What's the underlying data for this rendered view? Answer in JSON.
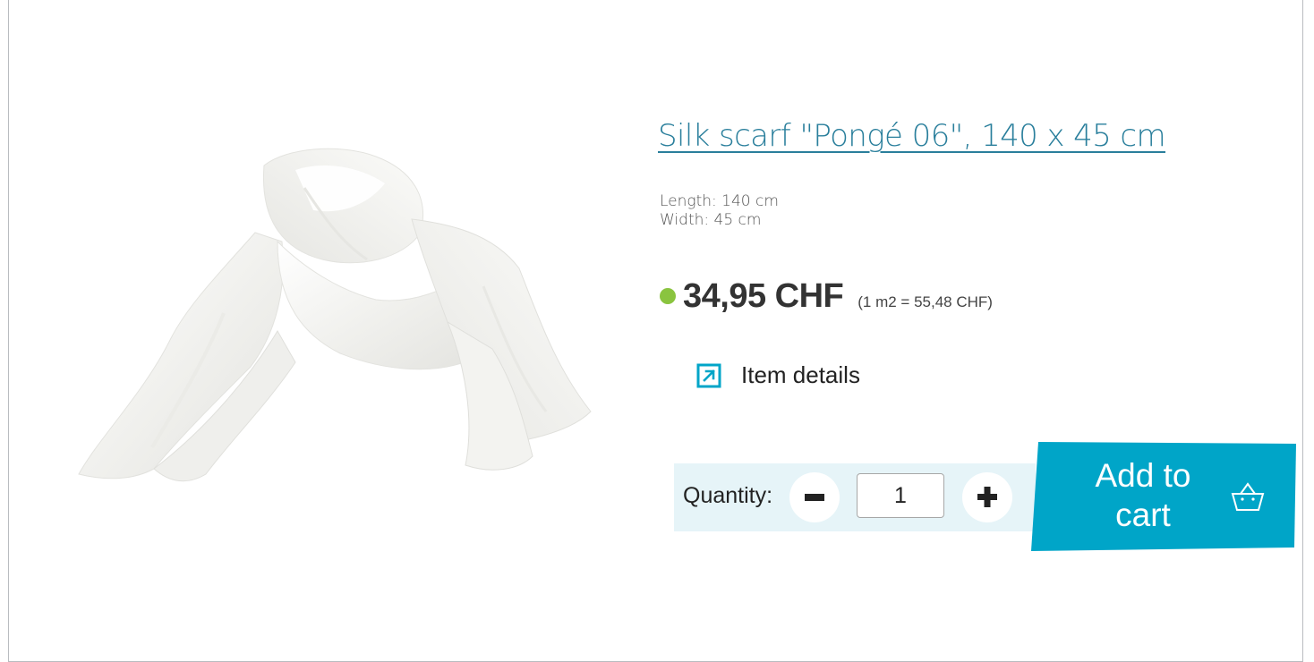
{
  "product": {
    "title": "Silk scarf \"Pongé 06\", 140 x 45 cm",
    "specs": {
      "length": "Length: 140 cm",
      "width": "Width: 45 cm"
    },
    "price": "34,95 CHF",
    "unit_price": "(1 m2 = 55,48 CHF)",
    "stock_color": "#8ac43f",
    "details_label": "Item details",
    "image_icon": "silk-scarf-image"
  },
  "quantity": {
    "label": "Quantity:",
    "value": "1",
    "minus_icon": "minus-icon",
    "plus_icon": "plus-icon"
  },
  "cart": {
    "label_line1": "Add to",
    "label_line2": "cart",
    "icon": "basket-icon",
    "color": "#00a5c8"
  },
  "colors": {
    "accent": "#00a5c8",
    "title": "#2a7f9c",
    "quantity_bg": "#e6f4f8"
  }
}
